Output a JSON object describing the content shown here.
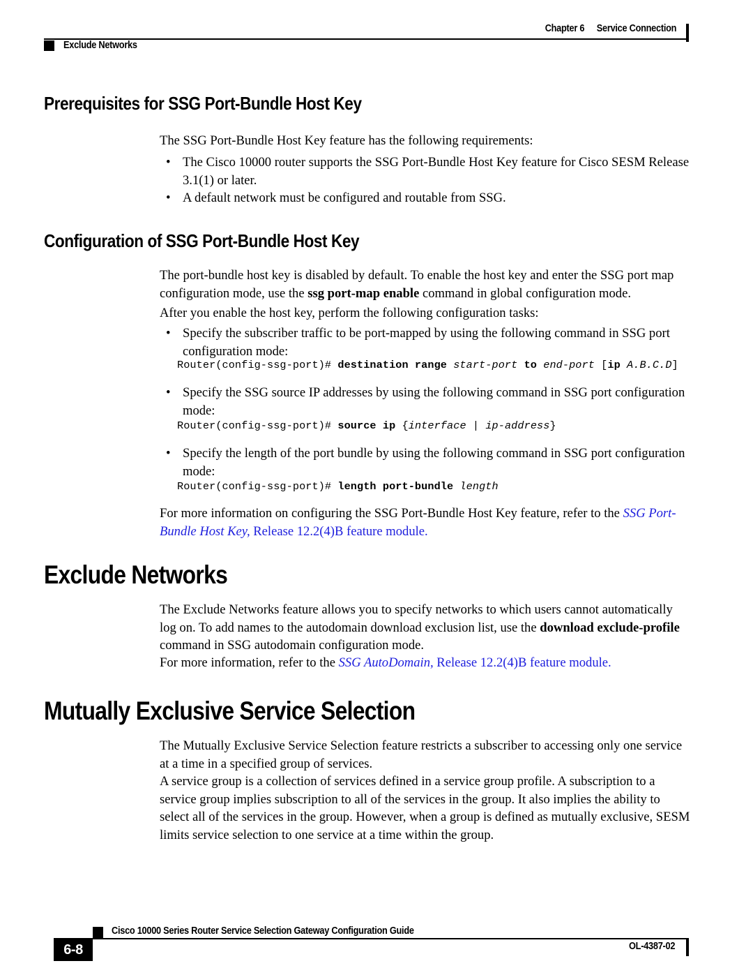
{
  "header": {
    "chapter": "Chapter 6",
    "chapter_title": "Service Connection",
    "section_label": "Exclude Networks"
  },
  "sections": {
    "prerequisites": {
      "heading": "Prerequisites for SSG Port-Bundle Host Key",
      "intro": "The SSG Port-Bundle Host Key feature has the following requirements:",
      "bullet1": "The Cisco 10000 router supports the SSG Port-Bundle Host Key feature for Cisco SESM Release 3.1(1) or later.",
      "bullet2": "A default network must be configured and routable from SSG."
    },
    "configuration": {
      "heading": "Configuration of SSG Port-Bundle Host Key",
      "para1_a": "The port-bundle host key is disabled by default. To enable the host key and enter the SSG port map configuration mode, use the ",
      "para1_bold": "ssg port-map enable",
      "para1_b": " command in global configuration mode.",
      "para2": "After you enable the host key, perform the following configuration tasks:",
      "bullet1": "Specify the subscriber traffic to be port-mapped by using the following command in SSG port configuration mode:",
      "cmd1": {
        "prompt": "Router(config-ssg-port)# ",
        "bold1": "destination range",
        "italic1": " start-port",
        "bold2": " to",
        "italic2": " end-port",
        "plain1": " [",
        "bold3": "ip",
        "italic3": " A.B.C.D",
        "plain2": "]"
      },
      "bullet2": "Specify the SSG source IP addresses by using the following command in SSG port configuration mode:",
      "cmd2": {
        "prompt": "Router(config-ssg-port)# ",
        "bold1": "source ip",
        "plain1": " {",
        "italic1": "interface",
        "plain2": " | ",
        "italic2": "ip-address",
        "plain3": "}"
      },
      "bullet3": "Specify the length of the port bundle by using the following command in SSG port configuration mode:",
      "cmd3": {
        "prompt": "Router(config-ssg-port)# ",
        "bold1": "length port-bundle",
        "italic1": " length"
      },
      "ref_lead": "For more information on configuring the SSG Port-Bundle Host Key feature, refer to the ",
      "ref_link_italic": "SSG Port-Bundle Host Key,",
      "ref_link_rest": " Release 12.2(4)B feature module."
    },
    "exclude_networks": {
      "heading": "Exclude Networks",
      "para1_a": "The Exclude Networks feature allows you to specify networks to which users cannot automatically log on. To add names to the autodomain download exclusion list, use the ",
      "para1_bold": "download exclude-profile",
      "para1_b": " command in SSG autodomain configuration mode.",
      "para2_lead": "For more information, refer to the ",
      "para2_link_italic": "SSG AutoDomain,",
      "para2_link_rest": " Release 12.2(4)B feature module."
    },
    "mutually_exclusive": {
      "heading": "Mutually Exclusive Service Selection",
      "para1": "The Mutually Exclusive Service Selection feature restricts a subscriber to accessing only one service at a time in a specified group of services.",
      "para2": "A service group is a collection of services defined in a service group profile. A subscription to a service group implies subscription to all of the services in the group. It also implies the ability to select all of the services in the group. However, when a group is defined as mutually exclusive, SESM limits service selection to one service at a time within the group."
    }
  },
  "bullet_glyph": "•",
  "footer": {
    "page_number": "6-8",
    "guide_title": "Cisco 10000 Series Router Service Selection Gateway Configuration Guide",
    "doc_id": "OL-4387-02"
  },
  "colors": {
    "link": "#1f20dd",
    "text": "#000000"
  }
}
